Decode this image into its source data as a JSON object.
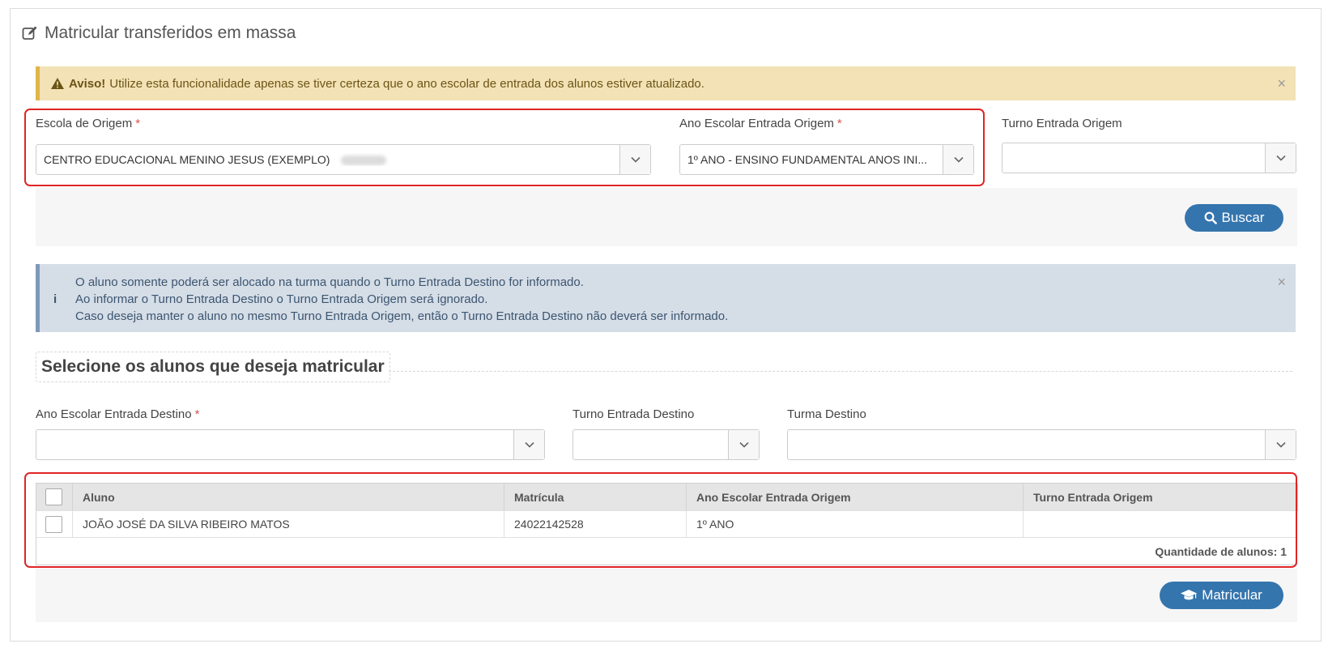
{
  "page": {
    "title": "Matricular transferidos em massa"
  },
  "warning": {
    "strong": "Aviso!",
    "text": "Utilize esta funcionalidade apenas se tiver certeza que o ano escolar de entrada dos alunos estiver atualizado.",
    "close": "×"
  },
  "origin": {
    "school": {
      "label": "Escola de Origem",
      "required": "*",
      "value": "CENTRO EDUCACIONAL MENINO JESUS (EXEMPLO)"
    },
    "grade": {
      "label": "Ano Escolar Entrada Origem",
      "required": "*",
      "value": "1º ANO - ENSINO FUNDAMENTAL ANOS INI..."
    },
    "shift": {
      "label": "Turno Entrada Origem",
      "value": ""
    }
  },
  "search_button": {
    "label": "Buscar"
  },
  "info": {
    "lines": [
      "O aluno somente poderá ser alocado na turma quando o Turno Entrada Destino for informado.",
      "Ao informar o Turno Entrada Destino o Turno Entrada Origem será ignorado.",
      "Caso deseja manter o aluno no mesmo Turno Entrada Origem, então o Turno Entrada Destino não deverá ser informado."
    ],
    "icon": "i",
    "close": "×"
  },
  "section": {
    "title": "Selecione os alunos que deseja matricular"
  },
  "destination": {
    "grade": {
      "label": "Ano Escolar Entrada Destino",
      "required": "*",
      "value": ""
    },
    "shift": {
      "label": "Turno Entrada Destino",
      "value": ""
    },
    "class": {
      "label": "Turma Destino",
      "value": ""
    }
  },
  "table": {
    "headers": [
      "Aluno",
      "Matrícula",
      "Ano Escolar Entrada Origem",
      "Turno Entrada Origem"
    ],
    "rows": [
      {
        "aluno": "JOÃO JOSÉ DA SILVA RIBEIRO MATOS",
        "matricula": "24022142528",
        "ano": "1º ANO",
        "turno": ""
      }
    ],
    "footer": "Quantidade de alunos: 1"
  },
  "enroll_button": {
    "label": "Matricular"
  },
  "colors": {
    "primary": "#3575ae",
    "warning_bg": "#f2e2b5",
    "info_bg": "#d5dde7",
    "highlight": "#e02424",
    "required": "#d9534f"
  }
}
